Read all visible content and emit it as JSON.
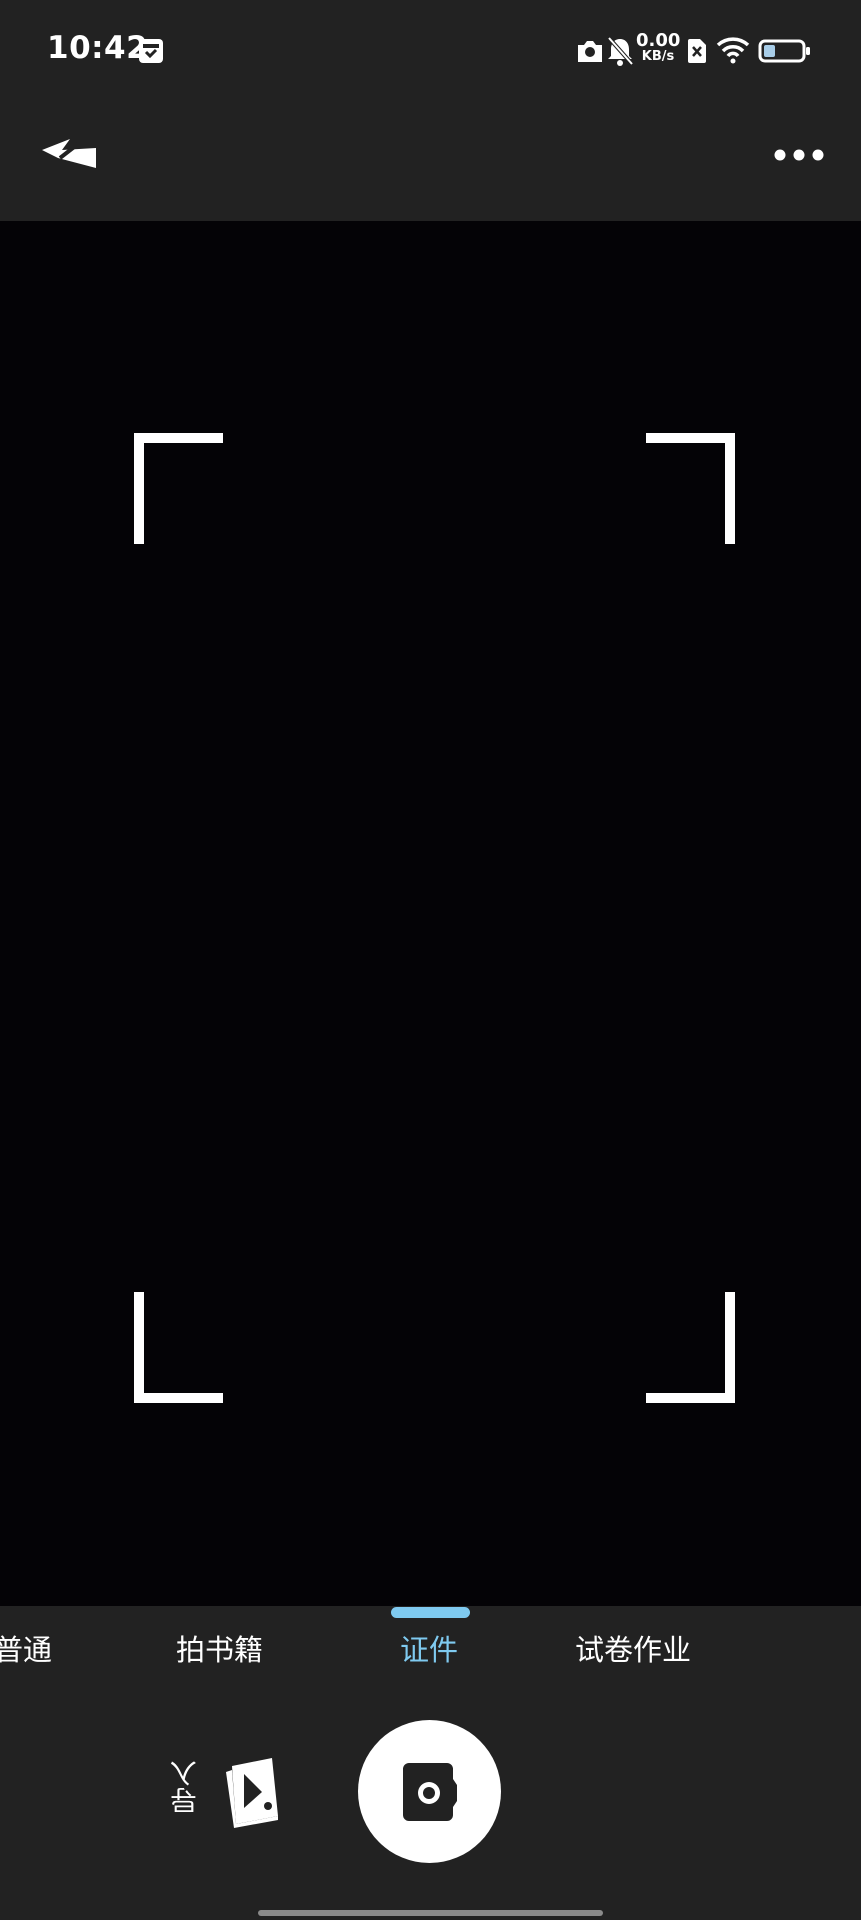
{
  "theme": {
    "accent": "#7fcaf0",
    "background": "#040306",
    "bar": "#222222"
  },
  "status_bar": {
    "time": "10:42",
    "net_speed_value": "0.00",
    "net_speed_unit": "KB/s",
    "battery_level": 0.3,
    "icons": [
      "calendar-icon",
      "camera-icon",
      "bell-muted-icon",
      "sim-error-icon",
      "wifi-icon",
      "battery-icon"
    ]
  },
  "toolbar": {
    "flash_icon": "flash-off-icon",
    "more_icon": "more-icon"
  },
  "modes": {
    "active_index": 2,
    "tabs": [
      {
        "label": "普通"
      },
      {
        "label": "拍书籍"
      },
      {
        "label": "证件"
      },
      {
        "label": "试卷作业"
      }
    ]
  },
  "controls": {
    "import_label": "导入",
    "import_icon": "gallery-import-icon",
    "shutter_icon": "shutter-camera-icon"
  }
}
